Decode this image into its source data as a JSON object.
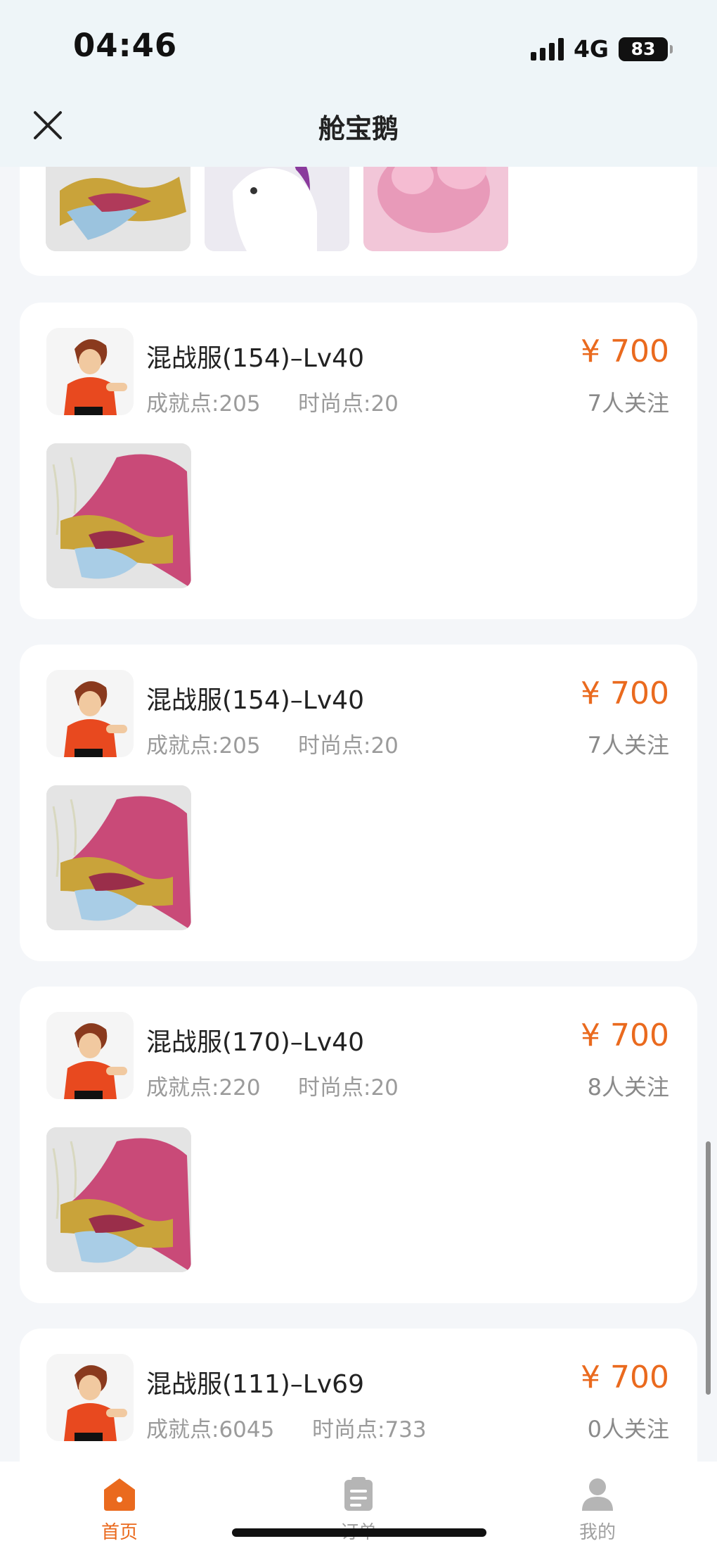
{
  "status": {
    "time": "04:46",
    "network": "4G",
    "battery": "83"
  },
  "header": {
    "title": "舱宝鹅"
  },
  "listings": [
    {
      "title": "混战服(154)–Lv40",
      "achievement": "成就点:205",
      "fashion": "时尚点:20",
      "price": "¥ 700",
      "follow": "7人关注"
    },
    {
      "title": "混战服(154)–Lv40",
      "achievement": "成就点:205",
      "fashion": "时尚点:20",
      "price": "¥ 700",
      "follow": "7人关注"
    },
    {
      "title": "混战服(170)–Lv40",
      "achievement": "成就点:220",
      "fashion": "时尚点:20",
      "price": "¥ 700",
      "follow": "8人关注"
    },
    {
      "title": "混战服(111)–Lv69",
      "achievement": "成就点:6045",
      "fashion": "时尚点:733",
      "price": "¥ 700",
      "follow": "0人关注"
    }
  ],
  "tabs": [
    {
      "label": "首页",
      "icon": "home-icon",
      "active": true
    },
    {
      "label": "订单",
      "icon": "clipboard-icon",
      "active": false
    },
    {
      "label": "我的",
      "icon": "user-icon",
      "active": false
    }
  ],
  "colors": {
    "accent": "#ea6a1e",
    "background": "#f4f6f9"
  }
}
